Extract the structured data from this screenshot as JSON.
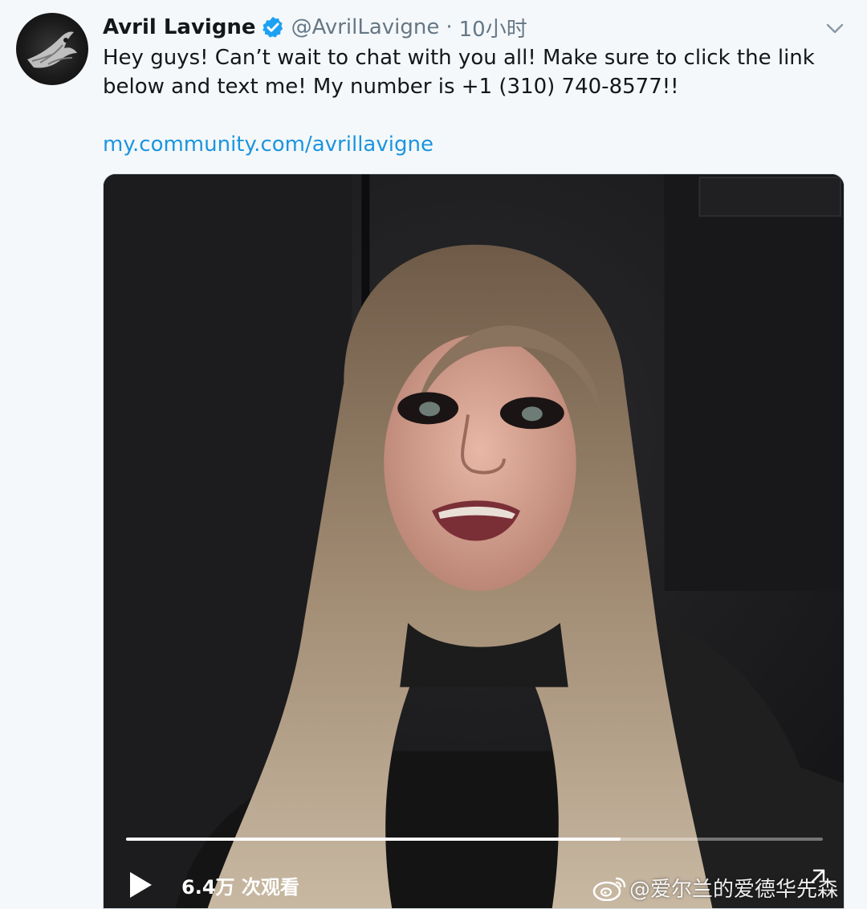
{
  "tweet": {
    "author_name": "Avril Lavigne",
    "verified_icon": "verified-badge-icon",
    "handle": "@AvrilLavigne",
    "separator": "·",
    "time": "10小时",
    "text": "Hey guys! Can’t wait to chat with you all! Make sure to click the link below and text me! My number is +1 (310) 740-8577!!",
    "link": "my.community.com/avrillavigne"
  },
  "video": {
    "progress_fraction": 0.71,
    "play_icon": "play-icon",
    "views": "6.4万 次观看"
  },
  "watermark": {
    "icon": "weibo-logo-icon",
    "text": "@爱尔兰的爱德华先森"
  },
  "colors": {
    "background": "#f5f8fa",
    "name": "#14171a",
    "secondary": "#657786",
    "link": "#1b95e0",
    "verified": "#1da1f2"
  }
}
